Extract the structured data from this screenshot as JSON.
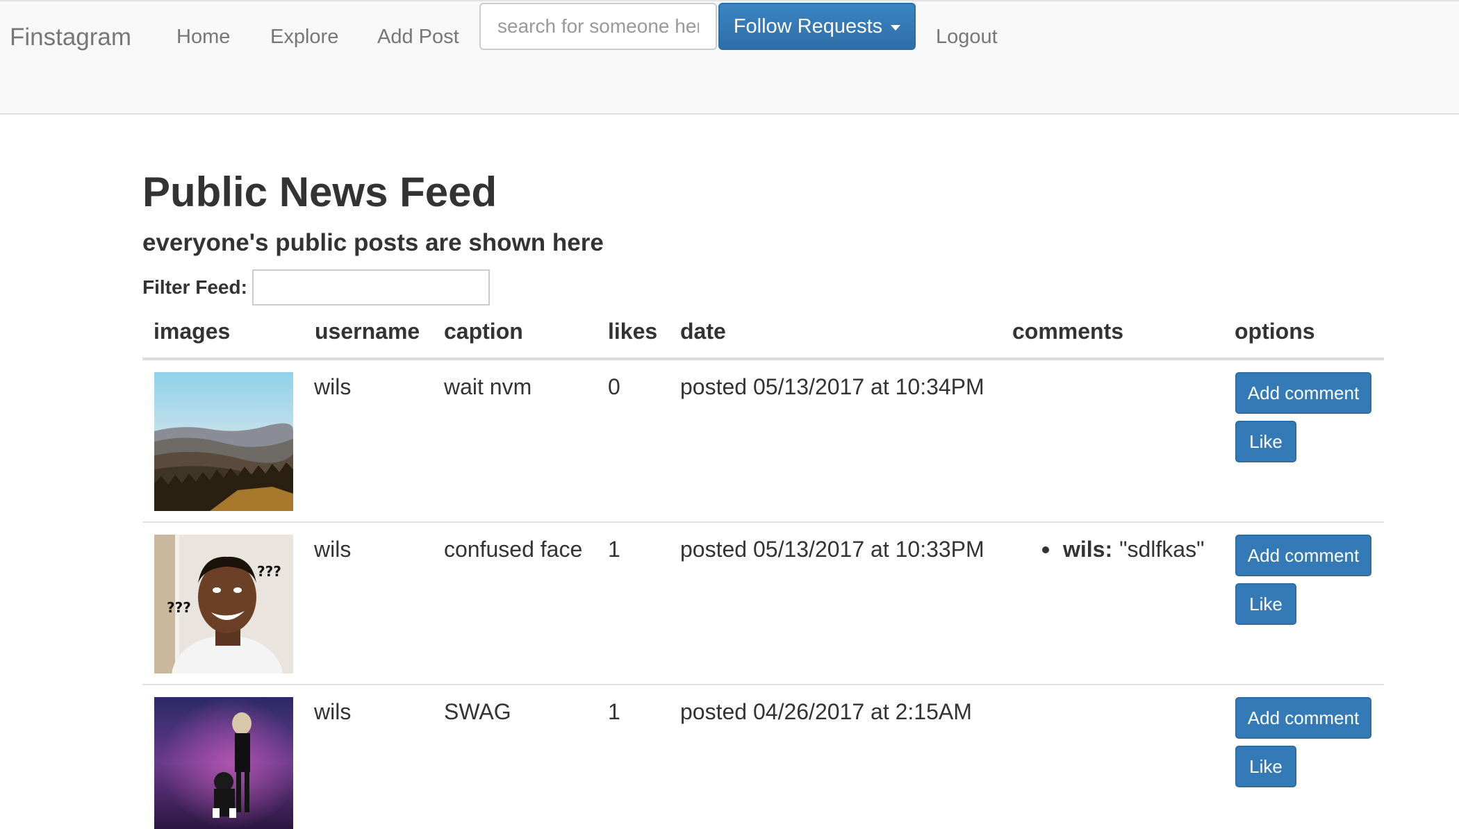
{
  "navbar": {
    "brand": "Finstagram",
    "links": [
      "Home",
      "Explore",
      "Add Post"
    ],
    "search_placeholder": "search for someone here",
    "follow_requests_label": "Follow Requests",
    "logout_label": "Logout"
  },
  "page": {
    "title": "Public News Feed",
    "subtitle": "everyone's public posts are shown here",
    "filter_label": "Filter Feed:",
    "filter_value": ""
  },
  "table": {
    "headers": [
      "images",
      "username",
      "caption",
      "likes",
      "date",
      "comments",
      "options"
    ],
    "rows": [
      {
        "image_icon": "landscape-photo",
        "username": "wils",
        "caption": "wait nvm",
        "likes": "0",
        "date": "posted 05/13/2017 at 10:34PM",
        "comments": [],
        "add_comment_label": "Add comment",
        "like_label": "Like"
      },
      {
        "image_icon": "confused-face-photo",
        "image_text": "???",
        "username": "wils",
        "caption": "confused face",
        "likes": "1",
        "date": "posted 05/13/2017 at 10:33PM",
        "comments": [
          {
            "user": "wils:",
            "text": "\"sdlfkas\""
          }
        ],
        "add_comment_label": "Add comment",
        "like_label": "Like"
      },
      {
        "image_icon": "stage-performance-photo",
        "username": "wils",
        "caption": "SWAG",
        "likes": "1",
        "date": "posted 04/26/2017 at 2:15AM",
        "comments": [],
        "add_comment_label": "Add comment",
        "like_label": "Like"
      }
    ]
  },
  "colors": {
    "primary": "#337ab7",
    "navbar_bg": "#f8f8f8",
    "nav_text": "#777777"
  }
}
